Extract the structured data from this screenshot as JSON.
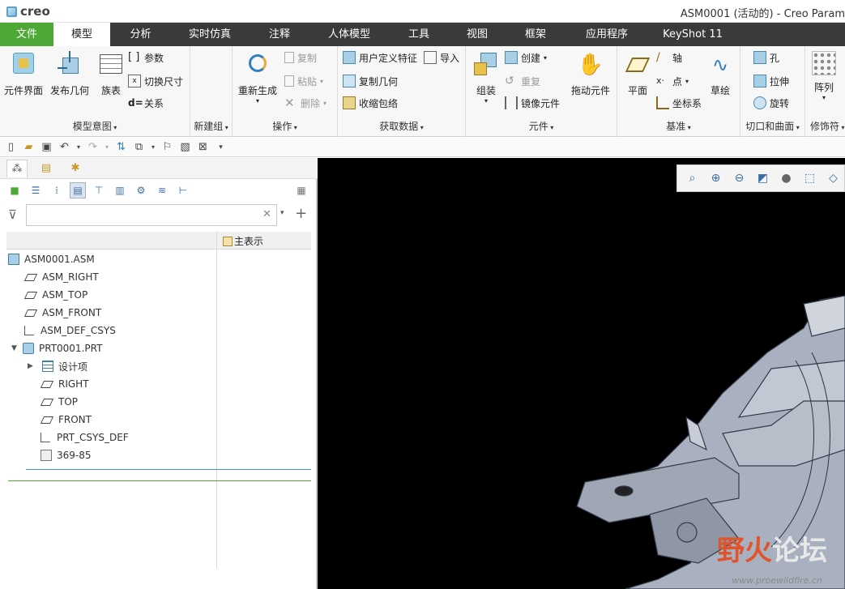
{
  "app": {
    "logo_text": "creo",
    "window_title": "ASM0001 (活动的) - Creo Param"
  },
  "menu": {
    "tabs": [
      {
        "label": "文件"
      },
      {
        "label": "模型"
      },
      {
        "label": "分析"
      },
      {
        "label": "实时仿真"
      },
      {
        "label": "注释"
      },
      {
        "label": "人体模型"
      },
      {
        "label": "工具"
      },
      {
        "label": "视图"
      },
      {
        "label": "框架"
      },
      {
        "label": "应用程序"
      },
      {
        "label": "KeyShot 11"
      }
    ]
  },
  "ribbon": {
    "model_intent": {
      "label": "模型意图",
      "component_interface": "元件界面",
      "publish_geometry": "发布几何",
      "family_table": "族表",
      "parameters": "参数",
      "switch_dimensions": "切换尺寸",
      "relations": "关系"
    },
    "new_group": {
      "label": "新建组"
    },
    "operations": {
      "label": "操作",
      "regenerate": "重新生成",
      "copy": "复制",
      "paste": "粘贴",
      "delete": "删除"
    },
    "get_data": {
      "label": "获取数据",
      "user_defined_feature": "用户定义特征",
      "import": "导入",
      "copy_geometry": "复制几何",
      "shrinkwrap": "收缩包络"
    },
    "component": {
      "label": "元件",
      "assemble": "组装",
      "create": "创建",
      "repeat": "重复",
      "mirror_component": "镜像元件",
      "drag_components": "拖动元件"
    },
    "datum": {
      "label": "基准",
      "plane": "平面",
      "axis": "轴",
      "point": "点",
      "csys": "坐标系",
      "sketch": "草绘"
    },
    "cut_surface": {
      "label": "切口和曲面",
      "hole": "孔",
      "extrude": "拉伸",
      "revolve": "旋转"
    },
    "modifiers": {
      "label": "修饰符",
      "pattern": "阵列"
    }
  },
  "panel": {
    "filter_placeholder": "",
    "column_header": "主表示",
    "tree": [
      {
        "label": "ASM0001.ASM",
        "icon": "assembly-icon"
      },
      {
        "label": "ASM_RIGHT",
        "icon": "datum-plane-icon"
      },
      {
        "label": "ASM_TOP",
        "icon": "datum-plane-icon"
      },
      {
        "label": "ASM_FRONT",
        "icon": "datum-plane-icon"
      },
      {
        "label": "ASM_DEF_CSYS",
        "icon": "csys-icon"
      },
      {
        "label": "PRT0001.PRT",
        "icon": "part-icon"
      },
      {
        "label": "设计项",
        "icon": "design-items-icon"
      },
      {
        "label": "RIGHT",
        "icon": "datum-plane-icon"
      },
      {
        "label": "TOP",
        "icon": "datum-plane-icon"
      },
      {
        "label": "FRONT",
        "icon": "datum-plane-icon"
      },
      {
        "label": "PRT_CSYS_DEF",
        "icon": "csys-icon"
      },
      {
        "label": "369-85",
        "icon": "import-feature-icon"
      }
    ]
  },
  "watermark": {
    "hot": "野火",
    "rest": "论坛",
    "url": "www.proewildfire.cn"
  }
}
